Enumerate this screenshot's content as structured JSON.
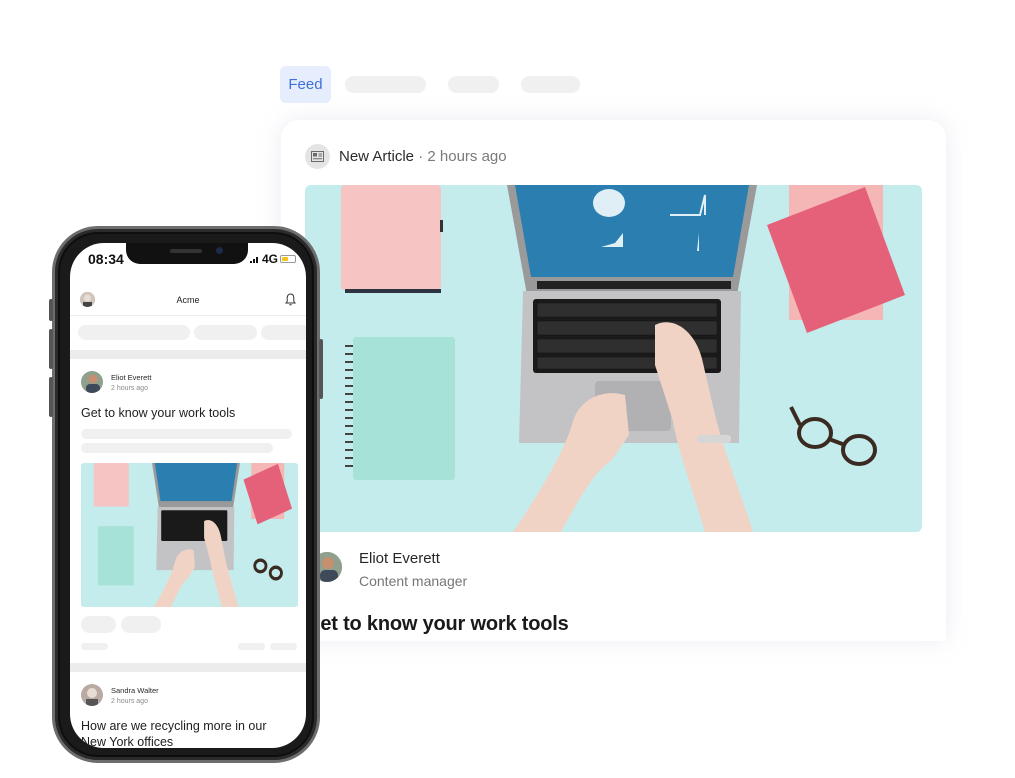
{
  "desktop": {
    "tabs": [
      {
        "label": "Feed",
        "active": true
      },
      {
        "label": "",
        "active": false,
        "placeholder": true
      },
      {
        "label": "",
        "active": false,
        "placeholder": true
      },
      {
        "label": "",
        "active": false,
        "placeholder": true
      }
    ],
    "card": {
      "icon": "article-icon",
      "type_label": "New Article",
      "separator": "·",
      "time": "2 hours ago",
      "image_alt": "Top-down photo of hands typing on a laptop with notebooks and glasses on a mint desk",
      "author": {
        "name": "Eliot Everett",
        "role": "Content manager"
      },
      "title": "Get to know your work tools"
    }
  },
  "phone": {
    "status_bar": {
      "time": "08:34",
      "network": "4G",
      "battery_level": 0.35
    },
    "app_bar": {
      "title": "Acme",
      "bell_icon": "bell-icon"
    },
    "posts": [
      {
        "author": "Eliot Everett",
        "time": "2 hours ago",
        "title": "Get to know your work tools",
        "has_image": true
      },
      {
        "author": "Sandra Walter",
        "time": "2 hours ago",
        "title": "How are we recycling more in our New York offices",
        "has_image": false
      }
    ]
  },
  "colors": {
    "accent": "#3f6fd8",
    "accent_bg": "#e6eefd",
    "skeleton": "#f0f0f0",
    "desk_mint": "#c4ecec"
  }
}
